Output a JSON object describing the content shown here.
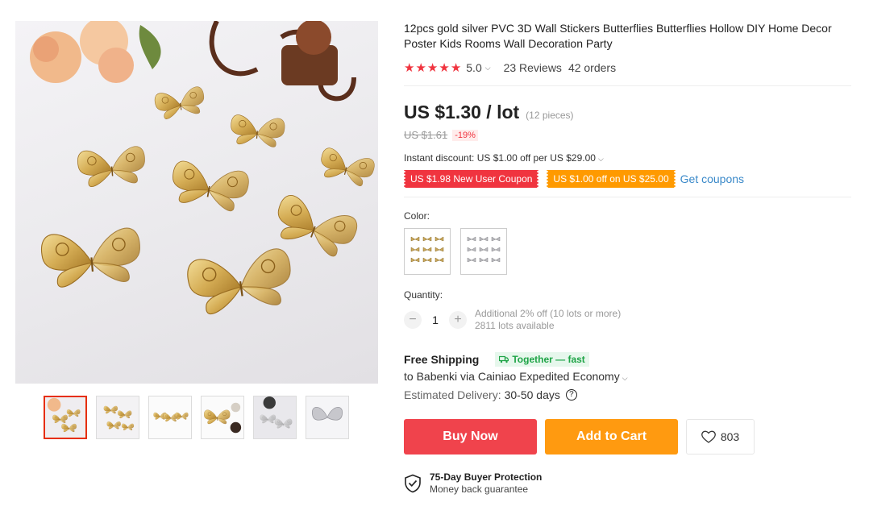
{
  "product": {
    "title": "12pcs gold silver PVC 3D Wall Stickers Butterflies Butterflies Hollow DIY Home Decor Poster Kids Rooms Wall Decoration Party",
    "rating": {
      "stars": 5,
      "value": "5.0",
      "reviews": "23 Reviews",
      "orders": "42 orders"
    },
    "price": {
      "current": "US $1.30 / lot",
      "pieces": "(12 pieces)",
      "original": "US $1.61",
      "discount": "-19%"
    },
    "instant_discount": "Instant discount: US $1.00 off per US $29.00",
    "coupons": [
      {
        "label": "US $1.98 New User Coupon",
        "color": "#f0343f"
      },
      {
        "label": "US $1.00 off on US $25.00",
        "color": "#ff9a00"
      }
    ],
    "get_coupons": "Get coupons"
  },
  "gallery": {
    "selected_index": 0,
    "thumbnail_count": 6
  },
  "options": {
    "color_label": "Color:",
    "colors": [
      {
        "name": "gold",
        "hex": "#c9a75a"
      },
      {
        "name": "silver",
        "hex": "#a9a9ad"
      }
    ],
    "quantity_label": "Quantity:",
    "quantity": "1",
    "qty_minus": "−",
    "qty_plus": "+",
    "quantity_note": "Additional 2% off (10 lots or more)",
    "available": "2811 lots available"
  },
  "shipping": {
    "title": "Free Shipping",
    "badge": "Together — fast",
    "to": "to Babenki via Cainiao Expedited Economy",
    "estimated_label": "Estimated Delivery:",
    "estimated_days": "30-50 days"
  },
  "actions": {
    "buy_now": "Buy Now",
    "add_to_cart": "Add to Cart",
    "wishlist_count": "803"
  },
  "protection": {
    "title": "75-Day Buyer Protection",
    "subtitle": "Money back guarantee"
  },
  "colors": {
    "accent_red": "#f0343f",
    "accent_orange": "#ff9a00",
    "link_blue": "#3a89c9",
    "green_badge": "#1fa447"
  }
}
